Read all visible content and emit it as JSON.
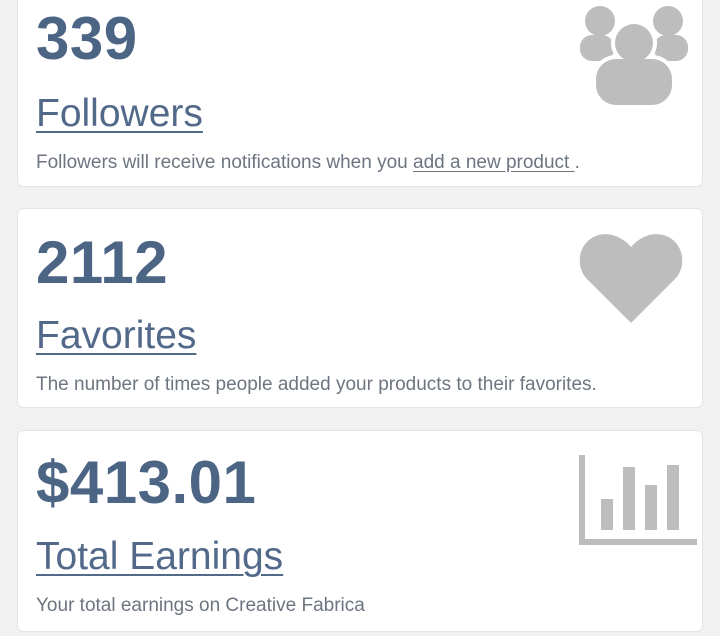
{
  "colors": {
    "background": "#f1f1f1",
    "card": "#ffffff",
    "number": "#4d6585",
    "title": "#53698a",
    "description": "#6d7580",
    "icon": "#bdbdbd"
  },
  "cards": {
    "followers": {
      "value": "339",
      "title": "Followers",
      "description_prefix": "Followers will receive notifications when you ",
      "description_link": "add a new product ",
      "description_suffix": ".",
      "icon": "users-group-icon"
    },
    "favorites": {
      "value": "2112",
      "title": "Favorites",
      "description": "The number of times people added your products to their favorites.",
      "icon": "heart-icon"
    },
    "earnings": {
      "value": "$413.01",
      "title": "Total Earnings",
      "description": "Your total earnings on Creative Fabrica",
      "icon": "bar-chart-icon"
    }
  }
}
